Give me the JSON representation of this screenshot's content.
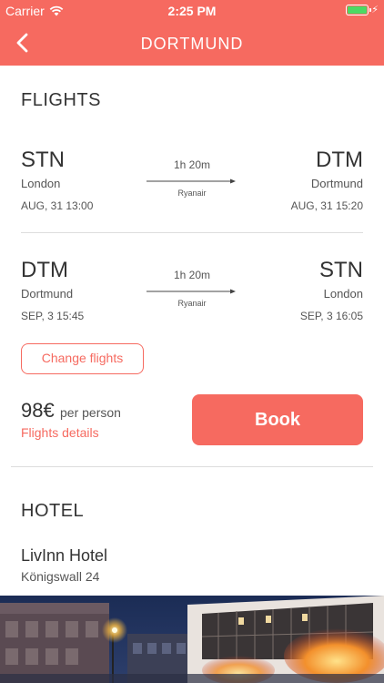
{
  "status_bar": {
    "carrier": "Carrier",
    "time": "2:25 PM"
  },
  "nav": {
    "title": "DORTMUND"
  },
  "flights": {
    "section_title": "FLIGHTS",
    "outbound": {
      "from_code": "STN",
      "from_city": "London",
      "from_datetime": "AUG, 31  13:00",
      "duration": "1h 20m",
      "airline": "Ryanair",
      "to_code": "DTM",
      "to_city": "Dortmund",
      "to_datetime": "AUG, 31  15:20"
    },
    "inbound": {
      "from_code": "DTM",
      "from_city": "Dortmund",
      "from_datetime": "SEP, 3  15:45",
      "duration": "1h 20m",
      "airline": "Ryanair",
      "to_code": "STN",
      "to_city": "London",
      "to_datetime": "SEP, 3  16:05"
    },
    "change_label": "Change flights",
    "price": "98€",
    "per_person": "per person",
    "details_label": "Flights details",
    "book_label": "Book"
  },
  "hotel": {
    "section_title": "HOTEL",
    "name": "LivInn Hotel",
    "address": "Königswall 24"
  },
  "colors": {
    "accent": "#f66a60",
    "battery": "#4cd964"
  }
}
